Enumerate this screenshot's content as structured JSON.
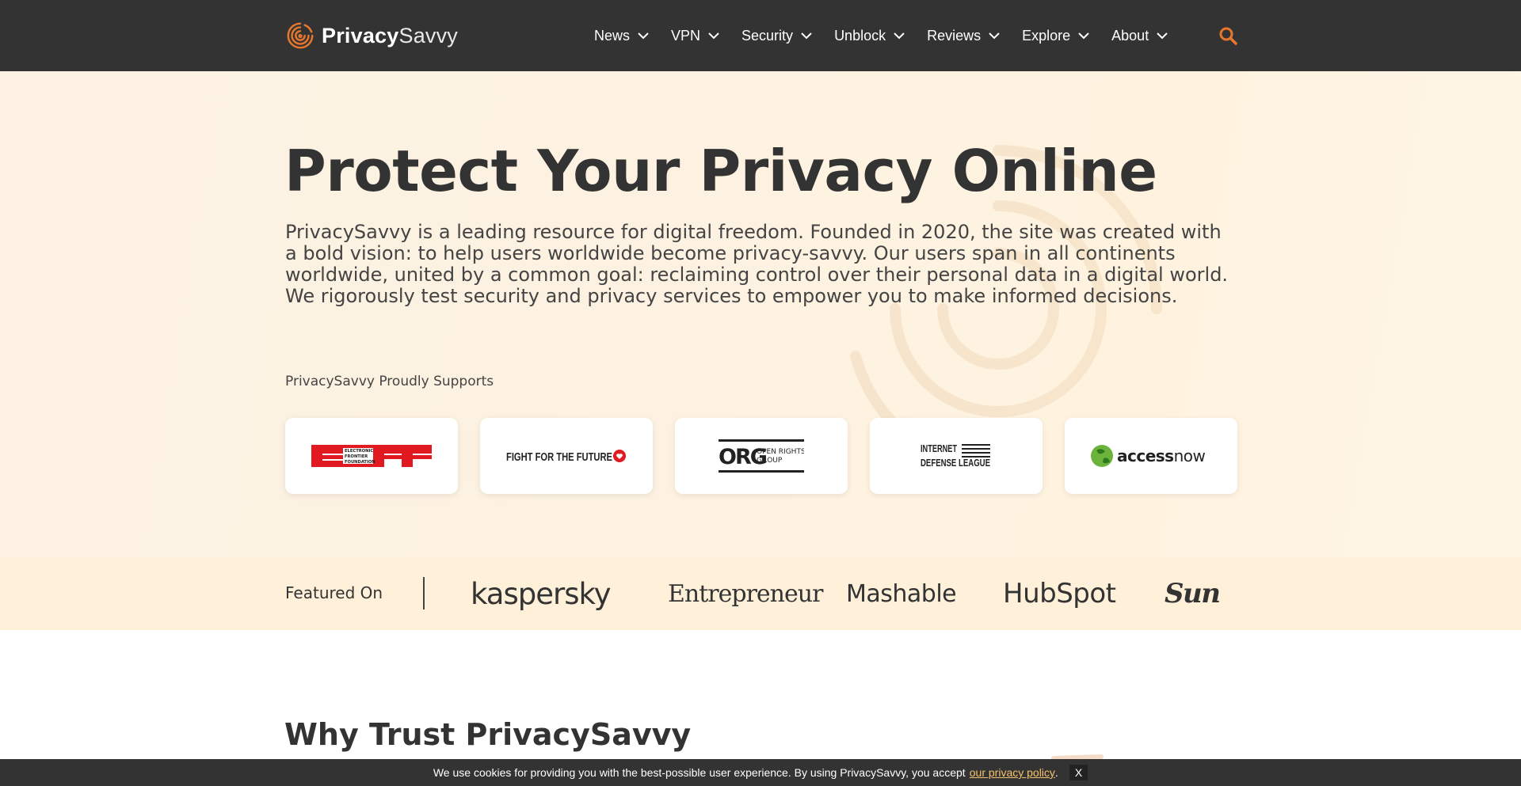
{
  "brand": {
    "name_bold": "Privacy",
    "name_light": "Savvy",
    "accent_color": "#e8772e",
    "icon": "fingerprint-logo-icon"
  },
  "nav": {
    "items": [
      {
        "label": "News"
      },
      {
        "label": "VPN"
      },
      {
        "label": "Security"
      },
      {
        "label": "Unblock"
      },
      {
        "label": "Reviews"
      },
      {
        "label": "Explore"
      },
      {
        "label": "About"
      }
    ],
    "search_icon": "search-icon"
  },
  "hero": {
    "title": "Protect Your Privacy Online",
    "description": "PrivacySavvy is a leading resource for digital freedom. Founded in 2020, the site was created with a bold vision: to help users worldwide become privacy-savvy. Our users span in all continents worldwide, united by a common goal: reclaiming control over their personal data in a digital world. We rigorously test security and privacy services to empower you to make informed decisions.",
    "supports_label": "PrivacySavvy Proudly Supports",
    "supporters": [
      {
        "name": "EFF",
        "subtext": [
          "ELECTRONIC",
          "FRONTIER",
          "FOUNDATION"
        ]
      },
      {
        "name": "FIGHT FOR THE FUTURE"
      },
      {
        "name": "ORG",
        "subtext": [
          "OPEN RIGHTS",
          "GROUP"
        ]
      },
      {
        "name": "INTERNET DEFENSE LEAGUE",
        "subtext": [
          "INTERNET",
          "DEFENSE LEAGUE"
        ]
      },
      {
        "name": "accessnow",
        "subtext": [
          "access",
          "now"
        ]
      }
    ]
  },
  "featured": {
    "label": "Featured On",
    "brands": [
      "kaspersky",
      "Entrepreneur",
      "Mashable",
      "HubSpot",
      "Sun"
    ]
  },
  "why": {
    "title": "Why Trust PrivacySavvy"
  },
  "cookie": {
    "text": "We use cookies for providing you with the best-possible user experience. By using PrivacySavvy, you accept",
    "link": "our privacy policy",
    "end": ".",
    "close": "X"
  }
}
